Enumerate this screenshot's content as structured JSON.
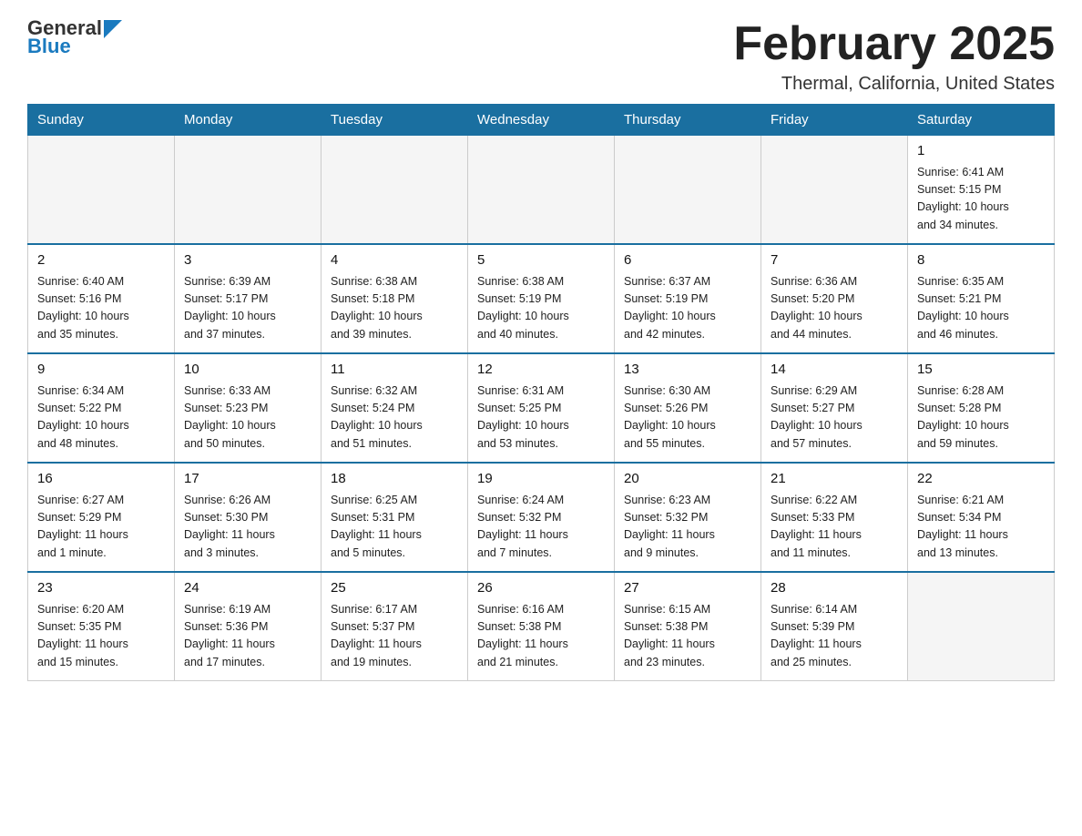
{
  "header": {
    "logo_general": "General",
    "logo_blue": "Blue",
    "month_title": "February 2025",
    "location": "Thermal, California, United States"
  },
  "days_of_week": [
    "Sunday",
    "Monday",
    "Tuesday",
    "Wednesday",
    "Thursday",
    "Friday",
    "Saturday"
  ],
  "weeks": [
    [
      {
        "day": "",
        "info": ""
      },
      {
        "day": "",
        "info": ""
      },
      {
        "day": "",
        "info": ""
      },
      {
        "day": "",
        "info": ""
      },
      {
        "day": "",
        "info": ""
      },
      {
        "day": "",
        "info": ""
      },
      {
        "day": "1",
        "info": "Sunrise: 6:41 AM\nSunset: 5:15 PM\nDaylight: 10 hours\nand 34 minutes."
      }
    ],
    [
      {
        "day": "2",
        "info": "Sunrise: 6:40 AM\nSunset: 5:16 PM\nDaylight: 10 hours\nand 35 minutes."
      },
      {
        "day": "3",
        "info": "Sunrise: 6:39 AM\nSunset: 5:17 PM\nDaylight: 10 hours\nand 37 minutes."
      },
      {
        "day": "4",
        "info": "Sunrise: 6:38 AM\nSunset: 5:18 PM\nDaylight: 10 hours\nand 39 minutes."
      },
      {
        "day": "5",
        "info": "Sunrise: 6:38 AM\nSunset: 5:19 PM\nDaylight: 10 hours\nand 40 minutes."
      },
      {
        "day": "6",
        "info": "Sunrise: 6:37 AM\nSunset: 5:19 PM\nDaylight: 10 hours\nand 42 minutes."
      },
      {
        "day": "7",
        "info": "Sunrise: 6:36 AM\nSunset: 5:20 PM\nDaylight: 10 hours\nand 44 minutes."
      },
      {
        "day": "8",
        "info": "Sunrise: 6:35 AM\nSunset: 5:21 PM\nDaylight: 10 hours\nand 46 minutes."
      }
    ],
    [
      {
        "day": "9",
        "info": "Sunrise: 6:34 AM\nSunset: 5:22 PM\nDaylight: 10 hours\nand 48 minutes."
      },
      {
        "day": "10",
        "info": "Sunrise: 6:33 AM\nSunset: 5:23 PM\nDaylight: 10 hours\nand 50 minutes."
      },
      {
        "day": "11",
        "info": "Sunrise: 6:32 AM\nSunset: 5:24 PM\nDaylight: 10 hours\nand 51 minutes."
      },
      {
        "day": "12",
        "info": "Sunrise: 6:31 AM\nSunset: 5:25 PM\nDaylight: 10 hours\nand 53 minutes."
      },
      {
        "day": "13",
        "info": "Sunrise: 6:30 AM\nSunset: 5:26 PM\nDaylight: 10 hours\nand 55 minutes."
      },
      {
        "day": "14",
        "info": "Sunrise: 6:29 AM\nSunset: 5:27 PM\nDaylight: 10 hours\nand 57 minutes."
      },
      {
        "day": "15",
        "info": "Sunrise: 6:28 AM\nSunset: 5:28 PM\nDaylight: 10 hours\nand 59 minutes."
      }
    ],
    [
      {
        "day": "16",
        "info": "Sunrise: 6:27 AM\nSunset: 5:29 PM\nDaylight: 11 hours\nand 1 minute."
      },
      {
        "day": "17",
        "info": "Sunrise: 6:26 AM\nSunset: 5:30 PM\nDaylight: 11 hours\nand 3 minutes."
      },
      {
        "day": "18",
        "info": "Sunrise: 6:25 AM\nSunset: 5:31 PM\nDaylight: 11 hours\nand 5 minutes."
      },
      {
        "day": "19",
        "info": "Sunrise: 6:24 AM\nSunset: 5:32 PM\nDaylight: 11 hours\nand 7 minutes."
      },
      {
        "day": "20",
        "info": "Sunrise: 6:23 AM\nSunset: 5:32 PM\nDaylight: 11 hours\nand 9 minutes."
      },
      {
        "day": "21",
        "info": "Sunrise: 6:22 AM\nSunset: 5:33 PM\nDaylight: 11 hours\nand 11 minutes."
      },
      {
        "day": "22",
        "info": "Sunrise: 6:21 AM\nSunset: 5:34 PM\nDaylight: 11 hours\nand 13 minutes."
      }
    ],
    [
      {
        "day": "23",
        "info": "Sunrise: 6:20 AM\nSunset: 5:35 PM\nDaylight: 11 hours\nand 15 minutes."
      },
      {
        "day": "24",
        "info": "Sunrise: 6:19 AM\nSunset: 5:36 PM\nDaylight: 11 hours\nand 17 minutes."
      },
      {
        "day": "25",
        "info": "Sunrise: 6:17 AM\nSunset: 5:37 PM\nDaylight: 11 hours\nand 19 minutes."
      },
      {
        "day": "26",
        "info": "Sunrise: 6:16 AM\nSunset: 5:38 PM\nDaylight: 11 hours\nand 21 minutes."
      },
      {
        "day": "27",
        "info": "Sunrise: 6:15 AM\nSunset: 5:38 PM\nDaylight: 11 hours\nand 23 minutes."
      },
      {
        "day": "28",
        "info": "Sunrise: 6:14 AM\nSunset: 5:39 PM\nDaylight: 11 hours\nand 25 minutes."
      },
      {
        "day": "",
        "info": ""
      }
    ]
  ]
}
